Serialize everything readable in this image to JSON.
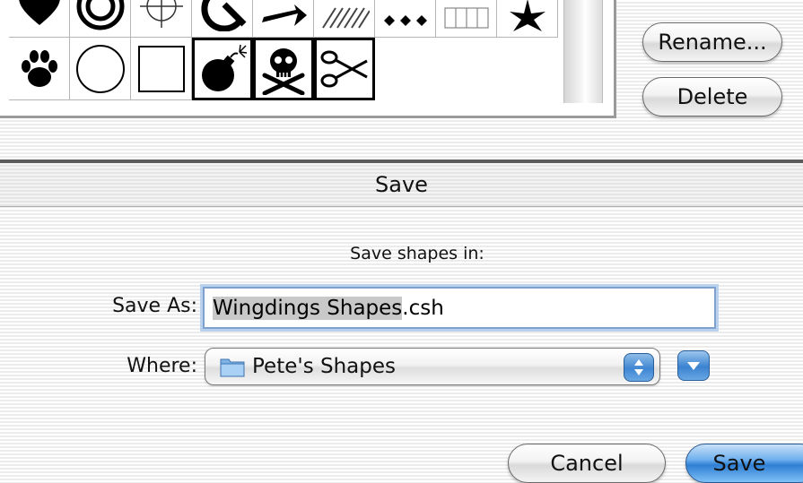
{
  "shape_library": {
    "row_top_icons": [
      "heart-suit-icon",
      "target-circle-icon",
      "crosshair-icon",
      "curved-arrow-icon",
      "arrow-shape-icon",
      "hatched-pattern-icon",
      "diamonds-icon",
      "grid-pattern-icon",
      "star-icon"
    ],
    "row_bottom_icons": [
      "paw-print-icon",
      "circle-outline-icon",
      "square-outline-icon",
      "bomb-icon",
      "skull-crossbones-icon",
      "scissors-icon"
    ],
    "rename_label": "Rename...",
    "delete_label": "Delete"
  },
  "sheet": {
    "title": "Save",
    "prompt": "Save shapes in:",
    "save_as_label": "Save As:",
    "filename_selected": "Wingdings Shapes",
    "filename_extension": ".csh",
    "where_label": "Where:",
    "where_value": "Pete's Shapes",
    "cancel_label": "Cancel",
    "save_label": "Save"
  },
  "colors": {
    "default_button_blue": "#2f7fd4",
    "focus_ring": "#7da2ce",
    "text_selection": "#c8c8c8"
  }
}
